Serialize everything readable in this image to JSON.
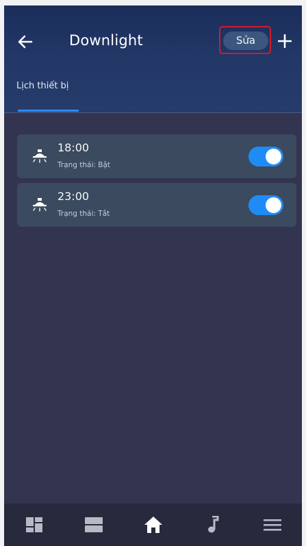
{
  "header": {
    "title": "Downlight",
    "edit_label": "Sửa",
    "back_icon": "arrow-left-icon",
    "add_icon": "plus-icon"
  },
  "tabs": [
    {
      "label": "Lịch thiết bị",
      "active": true
    }
  ],
  "schedules": [
    {
      "time": "18:00",
      "status": "Trạng thái: Bật",
      "enabled": true,
      "icon": "ceiling-light-icon"
    },
    {
      "time": "23:00",
      "status": "Trạng thái: Tắt",
      "enabled": true,
      "icon": "ceiling-light-icon"
    }
  ],
  "bottom_nav": [
    {
      "icon": "dashboard-icon",
      "active": false
    },
    {
      "icon": "rooms-icon",
      "active": false
    },
    {
      "icon": "home-icon",
      "active": true
    },
    {
      "icon": "music-icon",
      "active": false
    },
    {
      "icon": "menu-icon",
      "active": false
    }
  ],
  "colors": {
    "accent": "#1f8cf5",
    "highlight_frame": "#d11b2b",
    "background": "#33344f",
    "card": "#3b4a5e"
  }
}
